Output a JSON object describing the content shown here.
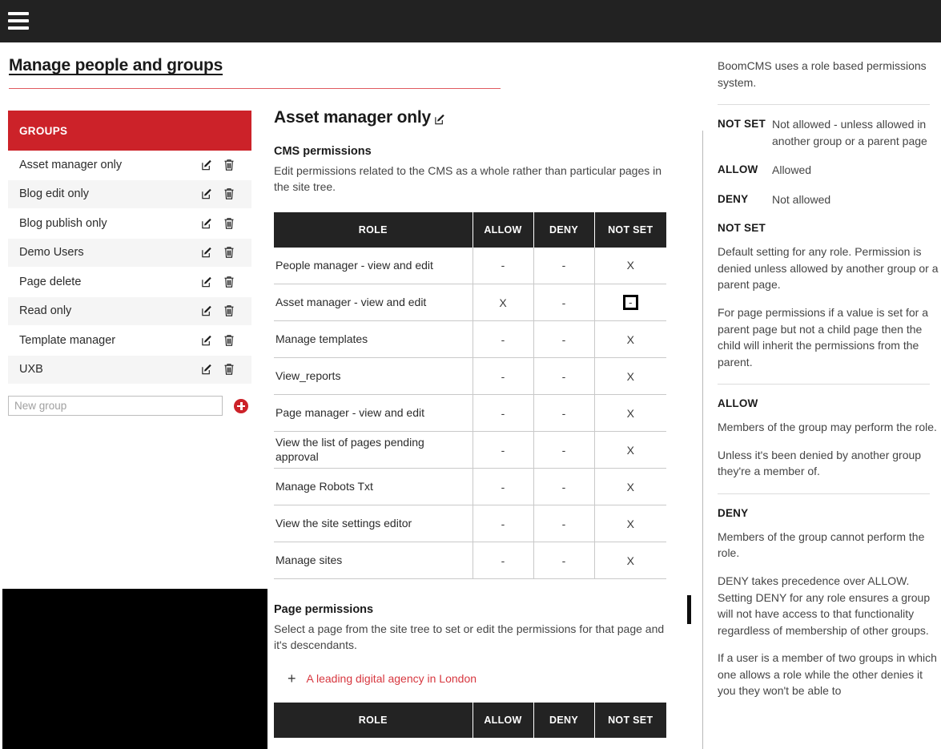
{
  "topbar": {
    "menu_icon": "hamburger-menu-icon"
  },
  "header": {
    "title": "Manage people and groups"
  },
  "groups_panel": {
    "header_label": "GROUPS",
    "items": [
      {
        "name": "Asset manager only"
      },
      {
        "name": "Blog edit only"
      },
      {
        "name": "Blog publish only"
      },
      {
        "name": "Demo Users"
      },
      {
        "name": "Page delete"
      },
      {
        "name": "Read only"
      },
      {
        "name": "Template manager"
      },
      {
        "name": "UXB"
      }
    ],
    "new_group_placeholder": "New group",
    "new_group_value": "",
    "add_label": "add-group-icon"
  },
  "center": {
    "group_title": "Asset manager only",
    "cms": {
      "heading": "CMS permissions",
      "description": "Edit permissions related to the CMS as a whole rather than particular pages in the site tree.",
      "columns": [
        "ROLE",
        "ALLOW",
        "DENY",
        "NOT SET"
      ],
      "rows": [
        {
          "role": "People manager - view and edit",
          "allow": "-",
          "deny": "-",
          "not_set": "X",
          "focused": false
        },
        {
          "role": "Asset manager - view and edit",
          "allow": "X",
          "deny": "-",
          "not_set": "-",
          "focused": true
        },
        {
          "role": "Manage templates",
          "allow": "-",
          "deny": "-",
          "not_set": "X",
          "focused": false
        },
        {
          "role": "View_reports",
          "allow": "-",
          "deny": "-",
          "not_set": "X",
          "focused": false
        },
        {
          "role": "Page manager - view and edit",
          "allow": "-",
          "deny": "-",
          "not_set": "X",
          "focused": false
        },
        {
          "role": "View the list of pages pending approval",
          "allow": "-",
          "deny": "-",
          "not_set": "X",
          "focused": false
        },
        {
          "role": "Manage Robots Txt",
          "allow": "-",
          "deny": "-",
          "not_set": "X",
          "focused": false
        },
        {
          "role": "View the site settings editor",
          "allow": "-",
          "deny": "-",
          "not_set": "X",
          "focused": false
        },
        {
          "role": "Manage sites",
          "allow": "-",
          "deny": "-",
          "not_set": "X",
          "focused": false
        }
      ]
    },
    "page_perms": {
      "heading": "Page permissions",
      "description": "Select a page from the site tree to set or edit the permissions for that page and it's descendants.",
      "tree_expand": "+",
      "tree_label": "A leading digital agency in London",
      "columns": [
        "ROLE",
        "ALLOW",
        "DENY",
        "NOT SET"
      ]
    }
  },
  "help": {
    "intro": "BoomCMS uses a role based permissions system.",
    "legend": [
      {
        "term": "NOT SET",
        "definition": "Not allowed - unless allowed in another group or a parent page"
      },
      {
        "term": "ALLOW",
        "definition": "Allowed"
      },
      {
        "term": "DENY",
        "definition": "Not allowed"
      }
    ],
    "sections": [
      {
        "heading": "NOT SET",
        "paragraphs": [
          "Default setting for any role. Permission is denied unless allowed by another group or a parent page.",
          "For page permissions if a value is set for a parent page but not a child page then the child will inherit the permissions from the parent."
        ]
      },
      {
        "heading": "ALLOW",
        "paragraphs": [
          "Members of the group may perform the role.",
          "Unless it's been denied by another group they're a member of."
        ]
      },
      {
        "heading": "DENY",
        "paragraphs": [
          "Members of the group cannot perform the role.",
          "DENY takes precedence over ALLOW. Setting DENY for any role ensures a group will not have access to that functionality regardless of membership of other groups.",
          "If a user is a member of two groups in which one allows a role while the other denies it you they won't be able to"
        ]
      }
    ]
  },
  "colors": {
    "brand_red": "#cc2229",
    "link_red": "#d7373f",
    "dark": "#232323"
  }
}
